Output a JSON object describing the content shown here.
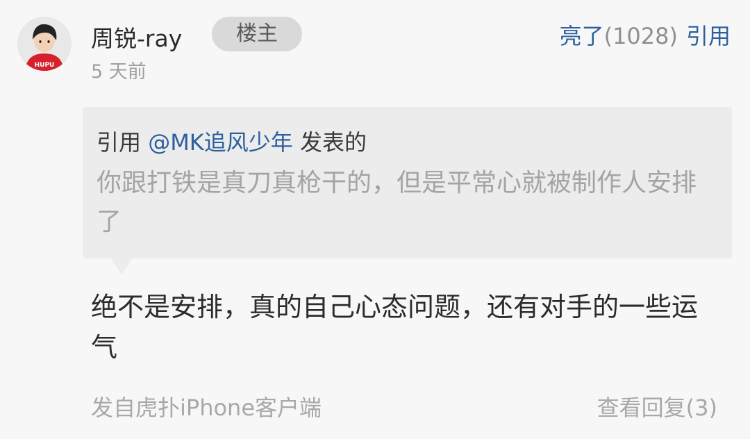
{
  "post": {
    "username": "周锐-ray",
    "op_badge": "楼主",
    "time": "5 天前",
    "light_label": "亮了",
    "light_count": "(1028)",
    "quote_button": "引用",
    "avatar_text": "HUPU"
  },
  "quote": {
    "prefix": "引用",
    "user": "@MK追风少年",
    "suffix": "发表的",
    "text": "你跟打铁是真刀真枪干的，但是平常心就被制作人安排了"
  },
  "reply": {
    "text": "绝不是安排，真的自己心态问题，还有对手的一些运气"
  },
  "footer": {
    "device": "发自虎扑iPhone客户端",
    "view_replies": "查看回复(3)"
  },
  "colors": {
    "link": "#2d5f9e",
    "muted": "#a8a8a8",
    "avatar_shirt": "#d6212d"
  }
}
